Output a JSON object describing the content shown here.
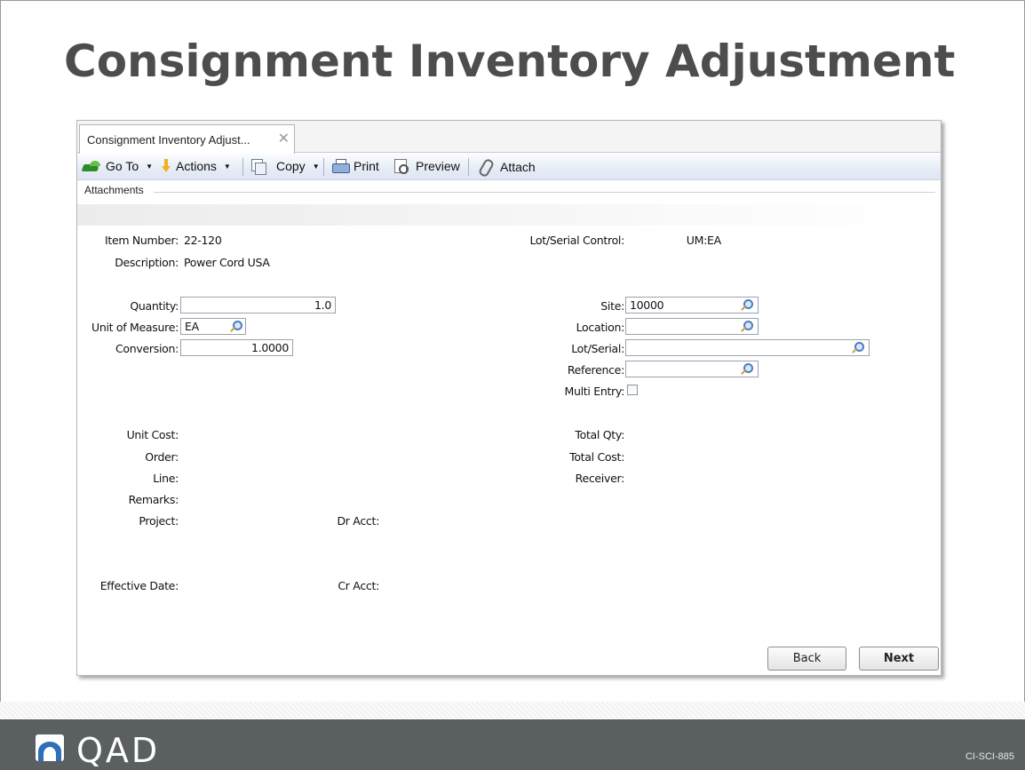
{
  "slide": {
    "title": "Consignment Inventory Adjustment",
    "code": "CI-SCI-885"
  },
  "brand": {
    "name": "QAD",
    "colors": {
      "footer": "#5a5f62",
      "logo": "#2f6fb5"
    }
  },
  "window": {
    "tab_label": "Consignment Inventory Adjust...",
    "toolbar": {
      "goto": "Go To",
      "actions": "Actions",
      "copy": "Copy",
      "print": "Print",
      "preview": "Preview",
      "attach": "Attach"
    },
    "attachments_label": "Attachments"
  },
  "form": {
    "item_number_label": "Item Number:",
    "item_number": "22-120",
    "description_label": "Description:",
    "description": "Power Cord USA",
    "lot_serial_control_label": "Lot/Serial Control:",
    "um_label": "UM:",
    "um": "EA",
    "quantity_label": "Quantity:",
    "quantity": "1.0",
    "unit_of_measure_label": "Unit of Measure:",
    "unit_of_measure": "EA",
    "conversion_label": "Conversion:",
    "conversion": "1.0000",
    "site_label": "Site:",
    "site": "10000",
    "location_label": "Location:",
    "location": "",
    "lot_serial_label": "Lot/Serial:",
    "lot_serial": "",
    "reference_label": "Reference:",
    "reference": "",
    "multi_entry_label": "Multi Entry:",
    "unit_cost_label": "Unit Cost:",
    "order_label": "Order:",
    "line_label": "Line:",
    "remarks_label": "Remarks:",
    "project_label": "Project:",
    "dr_acct_label": "Dr Acct:",
    "effective_date_label": "Effective Date:",
    "cr_acct_label": "Cr Acct:",
    "total_qty_label": "Total Qty:",
    "total_cost_label": "Total Cost:",
    "receiver_label": "Receiver:"
  },
  "buttons": {
    "back": "Back",
    "next": "Next"
  }
}
